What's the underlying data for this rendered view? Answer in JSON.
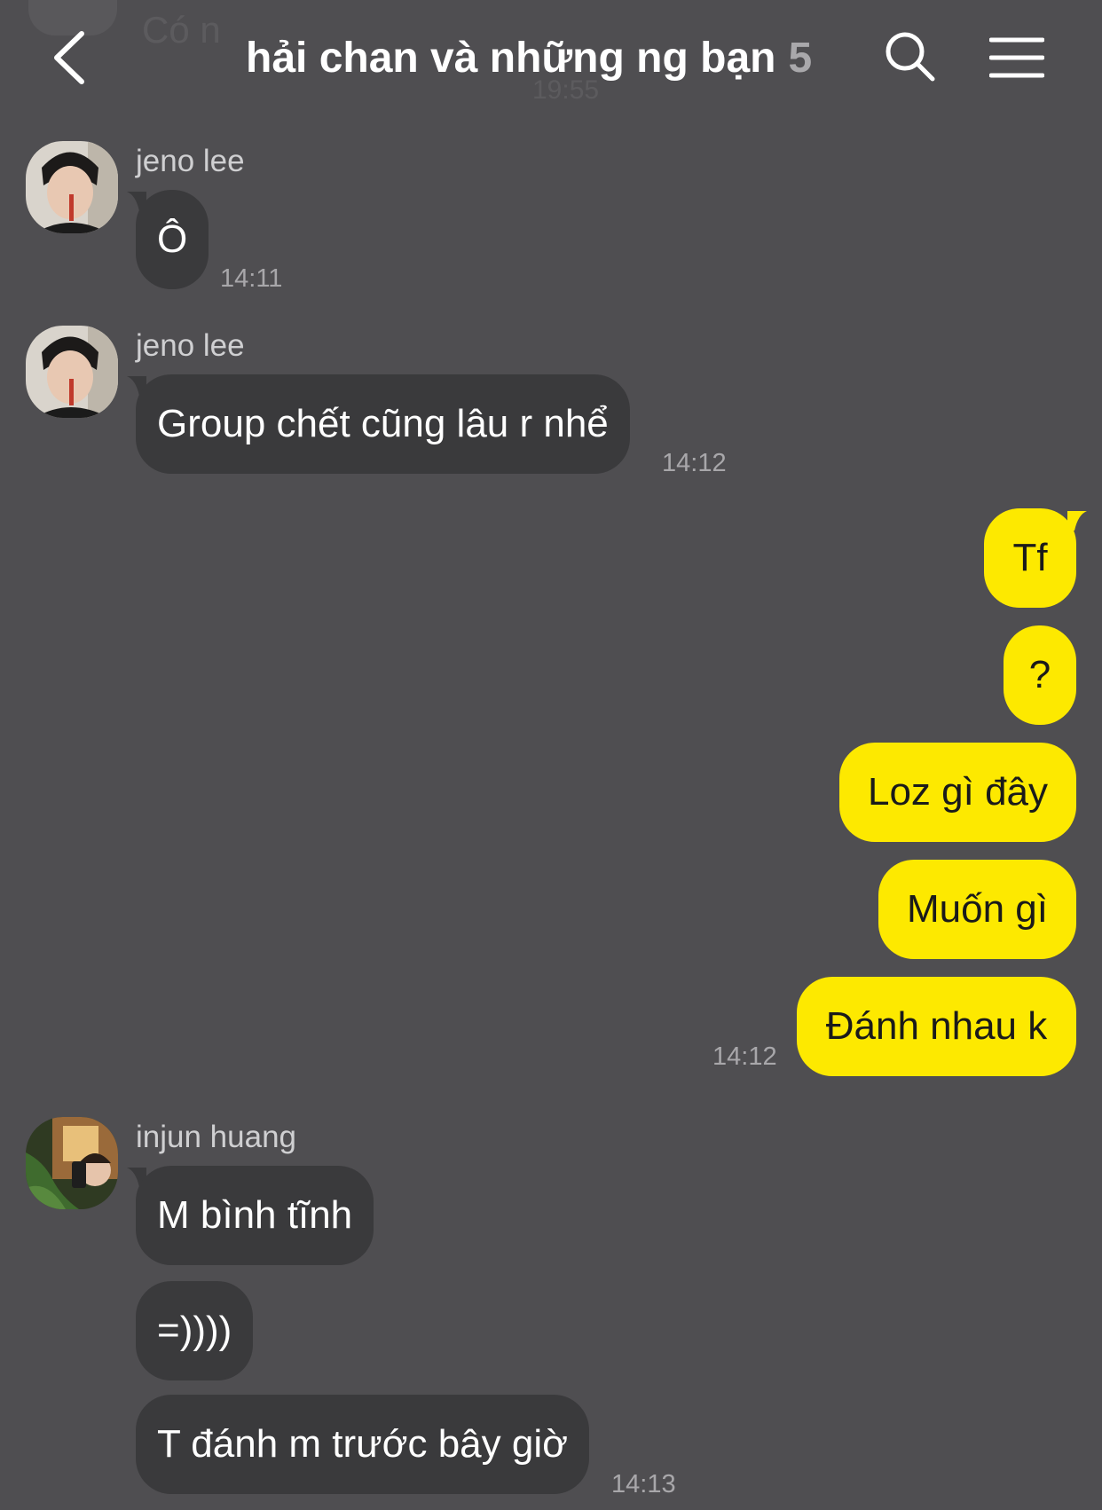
{
  "header": {
    "ghost_preview": "Có n",
    "ghost_time": "19:55",
    "title": "hải chan và những ng bạn",
    "member_count": "5",
    "back_icon": "chevron-left-icon",
    "search_icon": "search-icon",
    "menu_icon": "hamburger-menu-icon"
  },
  "colors": {
    "background": "#4f4e51",
    "incoming_bubble": "#3a3a3c",
    "outgoing_bubble": "#fde900",
    "timestamp": "#a8a7aa"
  },
  "messages": {
    "m1": {
      "sender": "jeno lee",
      "text": "Ô",
      "time": "14:11"
    },
    "m2": {
      "sender": "jeno lee",
      "text": "Group chết cũng lâu r nhể",
      "time": "14:12"
    },
    "out": {
      "texts": [
        "Tf",
        "?",
        "Loz gì đây",
        "Muốn gì",
        "Đánh nhau k"
      ],
      "time": "14:12"
    },
    "m3": {
      "sender": "injun huang",
      "texts": [
        "M bình tĩnh",
        "=))))",
        "T đánh m trước bây giờ"
      ],
      "time": "14:13"
    }
  }
}
